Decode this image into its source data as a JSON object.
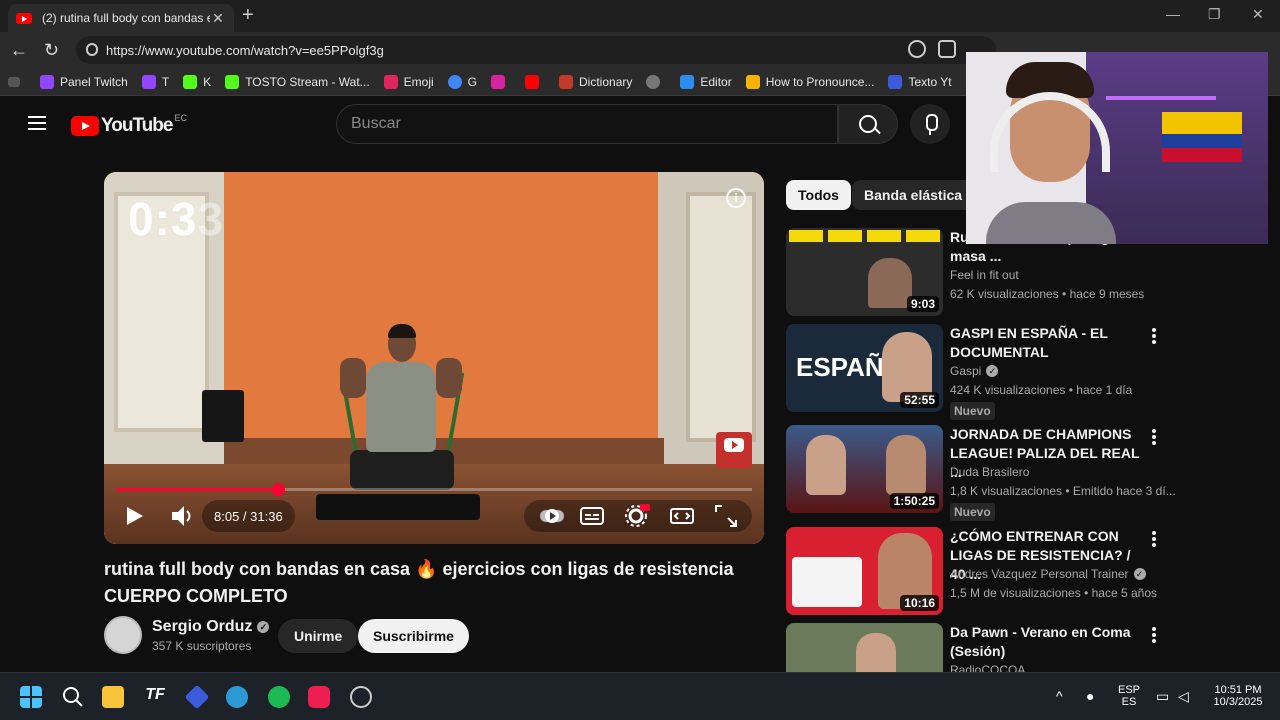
{
  "browser": {
    "tab_title": "(2) rutina full body con bandas en casa",
    "url": "https://www.youtube.com/watch?v=ee5PPolgf3g",
    "bookmarks": [
      "Panel Twitch",
      "T",
      "K",
      "TOSTO Stream - Wat...",
      "Emoji",
      "G",
      "",
      "",
      "Dictionary",
      "",
      "Editor",
      "How to Pronounce...",
      "Texto Yt"
    ]
  },
  "youtube": {
    "logo_text": "YouTube",
    "region": "EC",
    "search_placeholder": "Buscar"
  },
  "player": {
    "overlay_timer": "0:3",
    "overlay_timer_ghost": "3",
    "time_display": "8:05 / 31:36",
    "progress": 0.255,
    "info_symbol": "i"
  },
  "video": {
    "title": "rutina full body con bandas en casa 🔥 ejercicios con ligas de resistencia CUERPO COMPLETO",
    "channel": "Sergio Orduz",
    "subscribers": "357 K suscriptores",
    "join_label": "Unirme",
    "subscribe_label": "Suscribirme"
  },
  "chips": [
    "Todos",
    "Banda elástica"
  ],
  "recommendations": [
    {
      "title": "Ru... ELASTICAS para ganar masa ...",
      "channel": "Feel in fit out",
      "meta": "62 K visualizaciones • hace 9 meses",
      "duration": "9:03",
      "badge": "",
      "thumb_color": "#2c2c2c"
    },
    {
      "title": "GASPI EN ESPAÑA - EL DOCUMENTAL",
      "channel": "Gaspi",
      "meta": "424 K visualizaciones • hace 1 día",
      "duration": "52:55",
      "badge": "Nuevo",
      "thumb_color": "#1a2a3a"
    },
    {
      "title": "JORNADA DE CHAMPIONS LEAGUE! PALIZA DEL REAL ...",
      "channel": "Duda Brasilero",
      "meta": "1,8 K visualizaciones • Emitido hace 3 dí...",
      "duration": "1:50:25",
      "badge": "Nuevo",
      "thumb_color": "#5a1414"
    },
    {
      "title": "¿CÓMO ENTRENAR CON LIGAS DE RESISTENCIA? / 40 ...",
      "channel": "Andres Vazquez Personal Trainer",
      "meta": "1,5 M de visualizaciones • hace 5 años",
      "duration": "10:16",
      "badge": "",
      "thumb_color": "#d82030"
    },
    {
      "title": "Da Pawn - Verano en Coma (Sesión)",
      "channel": "RadioCOCOA",
      "meta": "",
      "duration": "",
      "badge": "",
      "thumb_color": "#6a7a5a"
    }
  ],
  "taskbar": {
    "lang_top": "ESP",
    "lang_bottom": "ES",
    "time": "10:51 PM",
    "date": "10/3/2025"
  }
}
